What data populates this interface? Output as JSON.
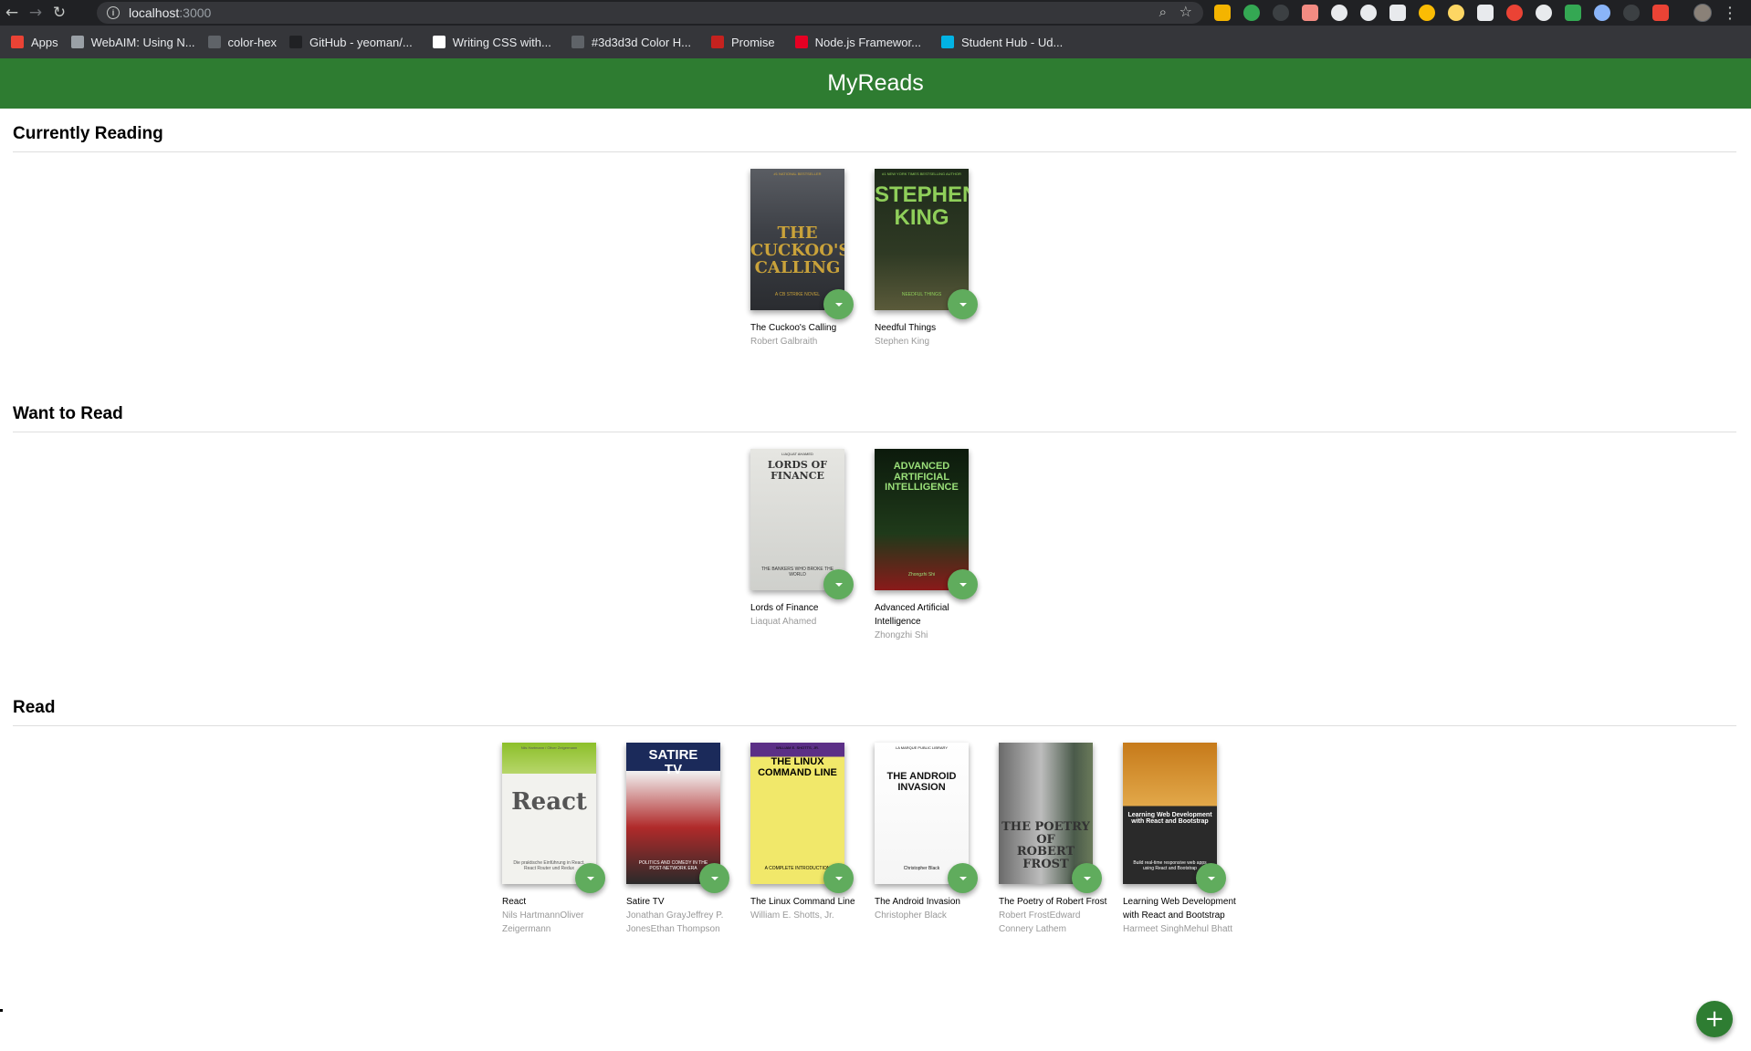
{
  "browser": {
    "url_host": "localhost",
    "url_port": ":3000",
    "bookmarks": [
      {
        "label": "Apps",
        "icon": "apps-grid-icon",
        "color": "#ea4335"
      },
      {
        "label": "WebAIM: Using N...",
        "icon": "webaim-icon",
        "color": "#9aa0a6"
      },
      {
        "label": "color-hex",
        "icon": "color-hex-icon",
        "color": "#5f6368"
      },
      {
        "label": "GitHub - yeoman/...",
        "icon": "github-icon",
        "color": "#202124"
      },
      {
        "label": "Writing CSS with...",
        "icon": "medium-icon",
        "color": "#ffffff"
      },
      {
        "label": "#3d3d3d Color H...",
        "icon": "color-hex-icon",
        "color": "#5f6368"
      },
      {
        "label": "Promise",
        "icon": "promise-icon",
        "color": "#c5221f"
      },
      {
        "label": "Node.js Framewor...",
        "icon": "pinterest-icon",
        "color": "#e60023"
      },
      {
        "label": "Student Hub - Ud...",
        "icon": "udacity-icon",
        "color": "#02b3e4"
      }
    ],
    "extensions": [
      "#f4b400",
      "#34a853",
      "#3c4043",
      "#f28b82",
      "#e8eaed",
      "#e8eaed",
      "#e8eaed",
      "#fbbc04",
      "#fdd663",
      "#e8eaed",
      "#ea4335",
      "#e8eaed",
      "#34a853",
      "#8ab4f8",
      "#3c4043",
      "#ea4335"
    ]
  },
  "app": {
    "title": "MyReads",
    "header_color": "#2e7c31",
    "changer_color": "#60ac5d",
    "add_button_icon": "plus-icon"
  },
  "shelves": [
    {
      "title": "Currently Reading",
      "books": [
        {
          "title": "The Cuckoo's Calling",
          "authors": "Robert Galbraith",
          "cover": "cuckoo"
        },
        {
          "title": "Needful Things",
          "authors": "Stephen King",
          "cover": "needful"
        }
      ]
    },
    {
      "title": "Want to Read",
      "books": [
        {
          "title": "Lords of Finance",
          "authors": "Liaquat Ahamed",
          "cover": "lords"
        },
        {
          "title": "Advanced Artificial Intelligence",
          "authors": "Zhongzhi Shi",
          "cover": "ai"
        }
      ]
    },
    {
      "title": "Read",
      "books": [
        {
          "title": "React",
          "authors": "Nils HartmannOliver Zeigermann",
          "cover": "react"
        },
        {
          "title": "Satire TV",
          "authors": "Jonathan GrayJeffrey P. JonesEthan Thompson",
          "cover": "satire"
        },
        {
          "title": "The Linux Command Line",
          "authors": "William E. Shotts, Jr.",
          "cover": "linux"
        },
        {
          "title": "The Android Invasion",
          "authors": "Christopher Black",
          "cover": "android"
        },
        {
          "title": "The Poetry of Robert Frost",
          "authors": "Robert FrostEdward Connery Lathem",
          "cover": "frost"
        },
        {
          "title": "Learning Web Development with React and Bootstrap",
          "authors": "Harmeet SinghMehul Bhatt",
          "cover": "webdev"
        }
      ]
    }
  ],
  "covers": {
    "cuckoo": {
      "lines": [
        "THE",
        "CUCKOO'S",
        "CALLING"
      ],
      "sub": "A CB STRIKE NOVEL",
      "top": "#1 NATIONAL BESTSELLER"
    },
    "needful": {
      "lines": [
        "STEPHEN",
        "KING"
      ],
      "sub": "NEEDFUL THINGS",
      "top": "#1 NEW YORK TIMES BESTSELLING AUTHOR"
    },
    "lords": {
      "lines": [
        "LORDS OF FINANCE"
      ],
      "sub": "THE BANKERS WHO BROKE THE WORLD",
      "top": "LIAQUAT AHAMED"
    },
    "ai": {
      "lines": [
        "ADVANCED",
        "ARTIFICIAL",
        "INTELLIGENCE"
      ],
      "sub": "Zhongzhi Shi",
      "top": ""
    },
    "react": {
      "lines": [
        "React"
      ],
      "sub": "Die praktische Einführung in React, React Router und Redux",
      "top": "Nils Hartmann / Oliver Zeigermann"
    },
    "satire": {
      "lines": [
        "SATIRE",
        "TV"
      ],
      "sub": "POLITICS AND COMEDY IN THE POST-NETWORK ERA",
      "top": ""
    },
    "linux": {
      "lines": [
        "THE LINUX",
        "COMMAND LINE"
      ],
      "sub": "A COMPLETE INTRODUCTION",
      "top": "WILLIAM E. SHOTTS, JR."
    },
    "android": {
      "lines": [
        "THE ANDROID",
        "INVASION"
      ],
      "sub": "Christopher Black",
      "top": "LA MARQUE PUBLIC LIBRARY"
    },
    "frost": {
      "lines": [
        "THE POETRY OF",
        "ROBERT",
        "FROST"
      ],
      "sub": "",
      "top": ""
    },
    "webdev": {
      "lines": [
        "Learning Web Development",
        "with React and Bootstrap"
      ],
      "sub": "Build real-time responsive web apps using React and Bootstrap",
      "top": ""
    }
  }
}
